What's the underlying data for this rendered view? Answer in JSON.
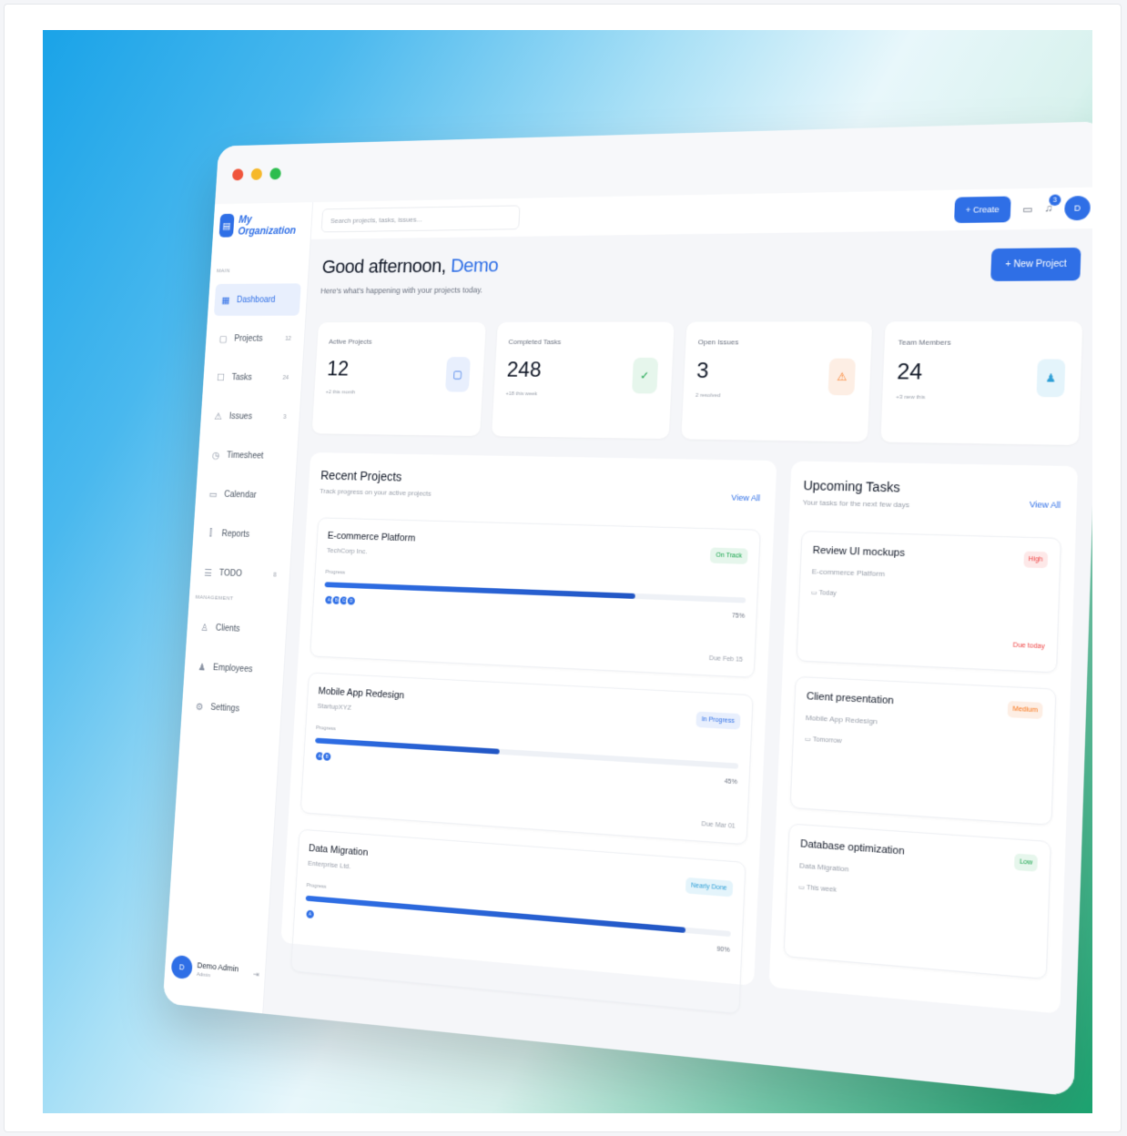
{
  "colors": {
    "accent": "#2f6fe6",
    "background_start": "#1aa3e8",
    "background_end": "#1ca873"
  },
  "sidebar": {
    "brand": {
      "name": "My Organization",
      "icon": "building-icon"
    },
    "main_label": "MAIN",
    "items": [
      {
        "label": "Dashboard",
        "icon": "dashboard-icon",
        "count": "",
        "active": true
      },
      {
        "label": "Projects",
        "icon": "folder-icon",
        "count": "12"
      },
      {
        "label": "Tasks",
        "icon": "checkbox-icon",
        "count": "24"
      },
      {
        "label": "Issues",
        "icon": "warning-icon",
        "count": "3"
      },
      {
        "label": "Timesheet",
        "icon": "clock-icon",
        "count": ""
      },
      {
        "label": "Calendar",
        "icon": "calendar-icon",
        "count": ""
      },
      {
        "label": "Reports",
        "icon": "chart-icon",
        "count": ""
      },
      {
        "label": "TODO",
        "icon": "list-icon",
        "count": "8"
      }
    ],
    "management_label": "MANAGEMENT",
    "management_items": [
      {
        "label": "Clients",
        "icon": "user-icon"
      },
      {
        "label": "Employees",
        "icon": "users-icon"
      },
      {
        "label": "Settings",
        "icon": "gear-icon"
      }
    ],
    "user": {
      "initial": "D",
      "name": "Demo Admin",
      "role": "Admin"
    }
  },
  "topbar": {
    "search_placeholder": "Search projects, tasks, issues...",
    "create_label": "+ Create",
    "notification_count": "3",
    "avatar_initial": "D"
  },
  "header": {
    "greeting": "Good afternoon,",
    "user_name": "Demo",
    "subtitle": "Here's what's happening with your projects today.",
    "new_project_label": "+ New Project"
  },
  "stats": [
    {
      "label": "Active Projects",
      "value": "12",
      "note": "+2 this month",
      "icon": "folder-icon",
      "color": "#2f6fe6",
      "bg": "#e8effd"
    },
    {
      "label": "Completed Tasks",
      "value": "248",
      "note": "+18 this week",
      "icon": "check-icon",
      "color": "#16a34a",
      "bg": "#e6f6ec"
    },
    {
      "label": "Open Issues",
      "value": "3",
      "note": "2 resolved",
      "icon": "warning-icon",
      "color": "#f97316",
      "bg": "#fdeee4"
    },
    {
      "label": "Team Members",
      "value": "24",
      "note": "+3 new this",
      "icon": "users-icon",
      "color": "#2f9fd6",
      "bg": "#e4f4fb"
    }
  ],
  "recent_projects": {
    "title": "Recent Projects",
    "subtitle": "Track progress on your active projects",
    "view_all": "View All",
    "items": [
      {
        "name": "E-commerce Platform",
        "client": "TechCorp Inc.",
        "status": "On Track",
        "status_color": "#16a34a",
        "status_bg": "#e6f6ec",
        "progress_label": "Progress",
        "progress": 75,
        "progress_text": "75%",
        "members": [
          "A",
          "B",
          "C",
          "D"
        ],
        "due": "Due Feb 15"
      },
      {
        "name": "Mobile App Redesign",
        "client": "StartupXYZ",
        "status": "In Progress",
        "status_color": "#2f6fe6",
        "status_bg": "#e8effd",
        "progress_label": "Progress",
        "progress": 45,
        "progress_text": "45%",
        "members": [
          "A",
          "B"
        ],
        "due": "Due Mar 01"
      },
      {
        "name": "Data Migration",
        "client": "Enterprise Ltd.",
        "status": "Nearly Done",
        "status_color": "#2f9fd6",
        "status_bg": "#e4f4fb",
        "progress_label": "Progress",
        "progress": 90,
        "progress_text": "90%",
        "members": [
          "A"
        ],
        "due": ""
      }
    ]
  },
  "upcoming_tasks": {
    "title": "Upcoming Tasks",
    "subtitle": "Your tasks for the next few days",
    "view_all": "View All",
    "items": [
      {
        "name": "Review UI mockups",
        "project": "E-commerce Platform",
        "when": "Today",
        "priority": "High",
        "priority_color": "#ef4444",
        "priority_bg": "#fde8e8",
        "due_note": "Due today"
      },
      {
        "name": "Client presentation",
        "project": "Mobile App Redesign",
        "when": "Tomorrow",
        "priority": "Medium",
        "priority_color": "#f97316",
        "priority_bg": "#fdeee4",
        "due_note": ""
      },
      {
        "name": "Database optimization",
        "project": "Data Migration",
        "when": "This week",
        "priority": "Low",
        "priority_color": "#16a34a",
        "priority_bg": "#e6f6ec",
        "due_note": ""
      }
    ]
  }
}
